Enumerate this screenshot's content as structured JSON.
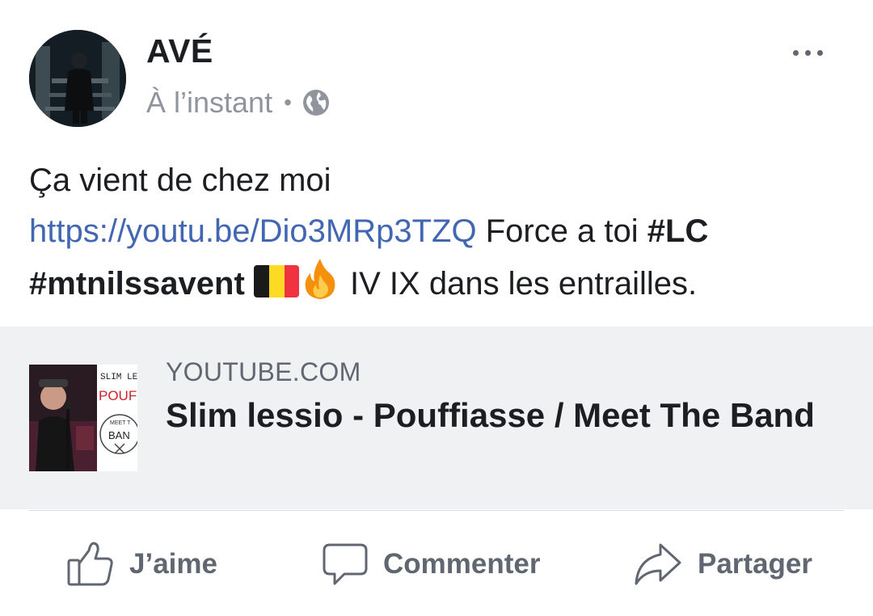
{
  "post": {
    "author": "AVÉ",
    "timestamp": "À l’instant",
    "separator": "•",
    "privacy_icon": "globe-icon",
    "more_icon": "more-options-icon",
    "text_line1": "Ça vient de chez moi",
    "link_url": "https://youtu.be/Dio3MRp3TZQ",
    "text_after_link": " Force a toi ",
    "hashtag_lc": "#LC",
    "hashtag_mtn": "#mtnilssavent",
    "flag_icon": "belgium-flag-emoji",
    "fire_icon": "fire-emoji",
    "text_end": " IV IX dans les entrailles."
  },
  "link_preview": {
    "source": "YOUTUBE.COM",
    "title": "Slim lessio - Pouffiasse / Meet The Band",
    "thumbnail_text_line1": "SLIM LE",
    "thumbnail_text_line2": "POUFFIA",
    "thumbnail_text_line3": "MEET T",
    "thumbnail_text_line4": "BAN"
  },
  "actions": {
    "like_label": "J’aime",
    "comment_label": "Commenter",
    "share_label": "Partager"
  },
  "colors": {
    "text": "#1c1e21",
    "secondary": "#90949c",
    "link": "#4267b2",
    "card_background": "#f0f1f3",
    "action_gray": "#606770"
  }
}
